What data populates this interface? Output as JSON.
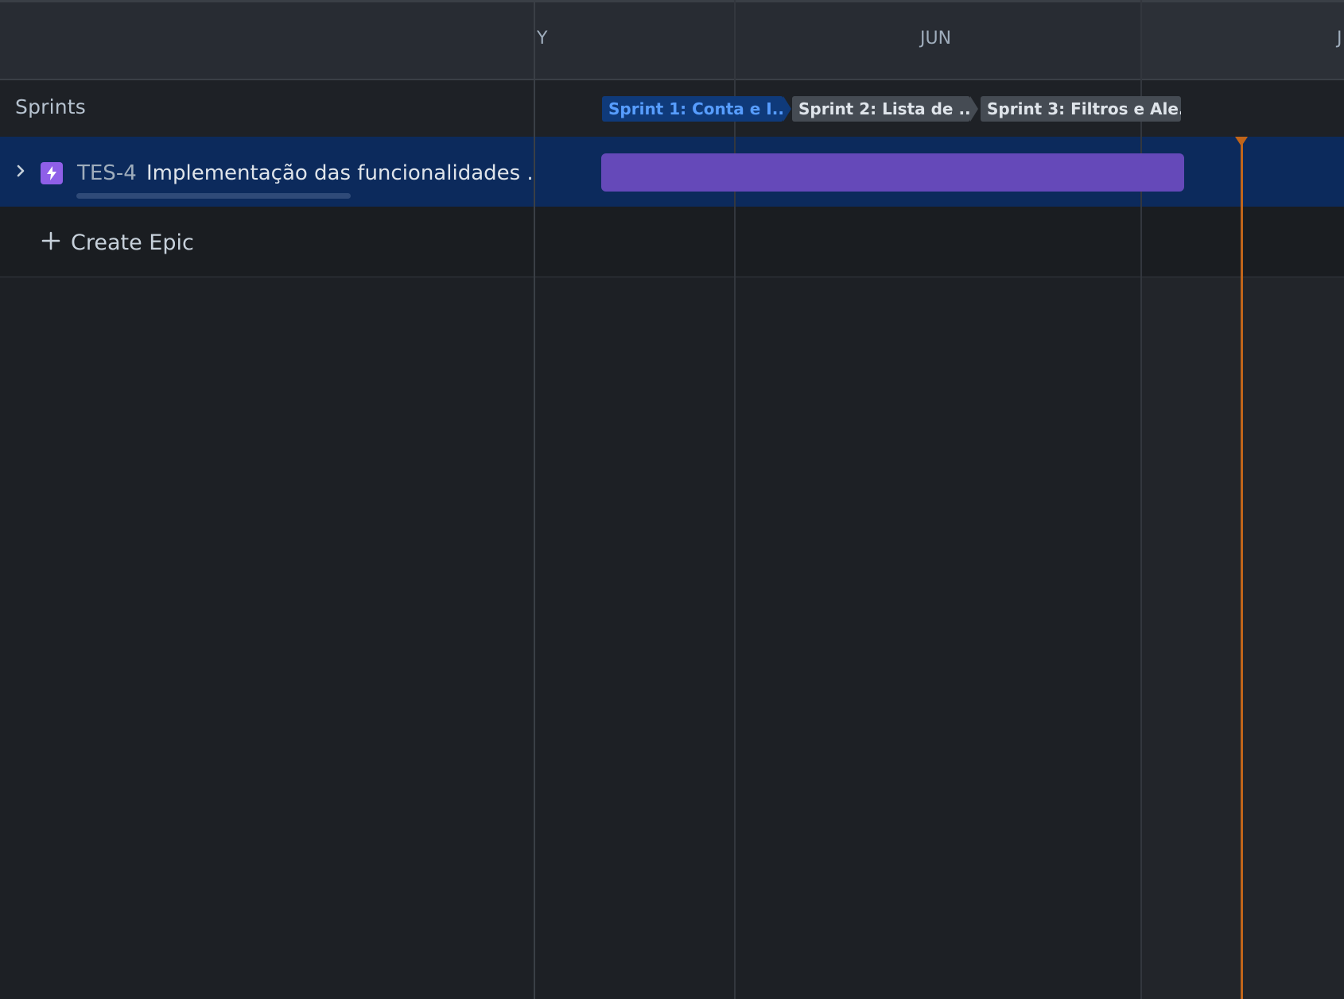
{
  "timeline": {
    "months": [
      "Y",
      "JUN",
      "J"
    ]
  },
  "sprints_row": {
    "label": "Sprints",
    "sprints": [
      {
        "label": "Sprint 1: Conta e I...",
        "state": "active"
      },
      {
        "label": "Sprint 2: Lista de ...",
        "state": "future"
      },
      {
        "label": "Sprint 3: Filtros e Ale...",
        "state": "future"
      }
    ]
  },
  "epic": {
    "key": "TES-4",
    "title": "Implementação das funcionalidades ...",
    "icon": "lightning-icon",
    "bar_color": "#6549b9"
  },
  "create": {
    "label": "Create Epic",
    "icon": "plus-icon"
  },
  "colors": {
    "today_line": "#c1651a",
    "selected_row": "#0c2a5c",
    "active_sprint": "#0f3a7a",
    "epic_icon": "#8f5fe8"
  }
}
